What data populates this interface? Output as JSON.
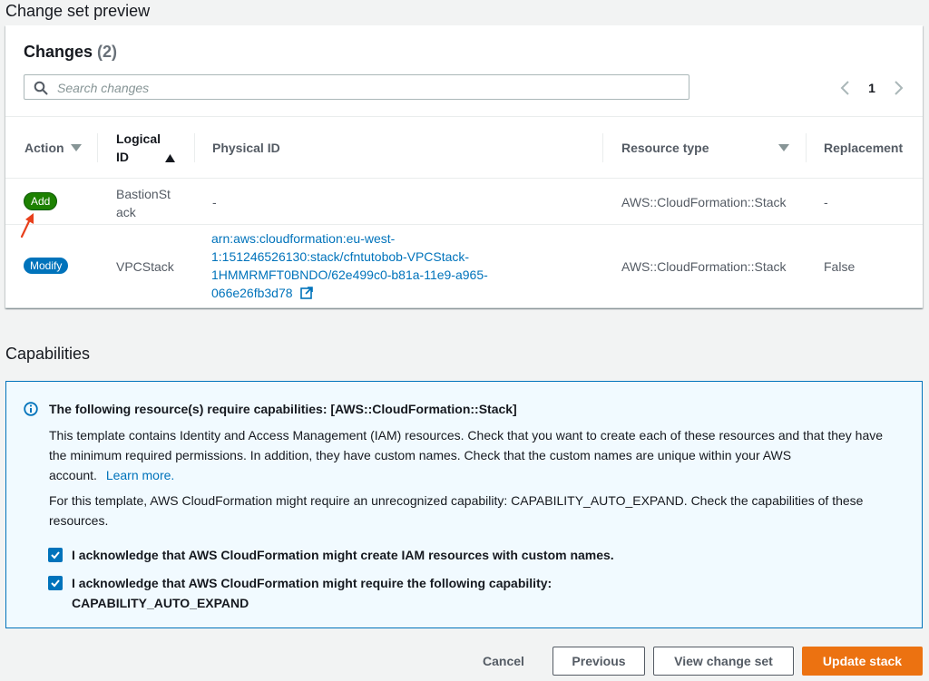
{
  "sections": {
    "preview_title": "Change set preview",
    "capabilities_title": "Capabilities"
  },
  "changes": {
    "heading": "Changes",
    "count": "(2)",
    "search_placeholder": "Search changes",
    "page": "1",
    "columns": {
      "action": "Action",
      "logical_id_line1": "Logical",
      "logical_id_line2": "ID",
      "physical_id": "Physical ID",
      "resource_type": "Resource type",
      "replacement": "Replacement"
    },
    "rows": [
      {
        "action": "Add",
        "logical_id_line1": "BastionSt",
        "logical_id_line2": "ack",
        "physical_id": "-",
        "resource_type": "AWS::CloudFormation::Stack",
        "replacement": "-"
      },
      {
        "action": "Modify",
        "logical_id": "VPCStack",
        "physical_id_lines": [
          "arn:aws:cloudformation:eu-west-",
          "1:151246526130:stack/cfntutobob-VPCStack-",
          "1HMMRMFT0BNDO/62e499c0-b81a-11e9-a965-",
          "066e26fb3d78"
        ],
        "resource_type": "AWS::CloudFormation::Stack",
        "replacement": "False"
      }
    ]
  },
  "capabilities": {
    "alert_title": "The following resource(s) require capabilities: [AWS::CloudFormation::Stack]",
    "para1_lines": [
      "This template contains Identity and Access Management (IAM) resources. Check that you want to create each of these resources and that they have",
      "the minimum required permissions. In addition, they have custom names. Check that the custom names are unique within your AWS",
      "account."
    ],
    "learn_more": "Learn more.",
    "para2_lines": [
      "For this template, AWS CloudFormation might require an unrecognized capability: CAPABILITY_AUTO_EXPAND. Check the capabilities of these",
      "resources."
    ],
    "ack1": "I acknowledge that AWS CloudFormation might create IAM resources with custom names.",
    "ack2_line1": "I acknowledge that AWS CloudFormation might require the following capability:",
    "ack2_line2": "CAPABILITY_AUTO_EXPAND"
  },
  "footer": {
    "cancel": "Cancel",
    "previous": "Previous",
    "view_change_set": "View change set",
    "update_stack": "Update stack"
  },
  "colors": {
    "link": "#0073bb",
    "add_badge": "#1d8102",
    "modify_badge": "#0073bb",
    "primary_button": "#ec7211",
    "annotation_arrow": "#e8401c"
  },
  "icons": {
    "search": "search-icon",
    "prev": "chevron-left-icon",
    "next": "chevron-right-icon",
    "external": "external-link-icon",
    "info": "info-icon",
    "check": "check-icon",
    "filter": "caret-down-icon",
    "sort": "sort-ascending-icon"
  }
}
